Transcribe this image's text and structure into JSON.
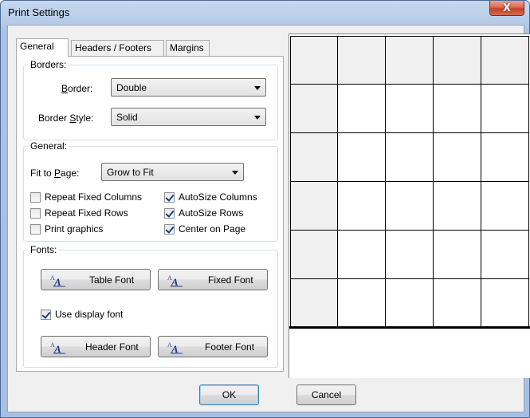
{
  "window": {
    "title": "Print Settings",
    "close_glyph": "X"
  },
  "tabs": [
    {
      "label": "General",
      "active": true
    },
    {
      "label": "Headers / Footers",
      "active": false
    },
    {
      "label": "Margins",
      "active": false
    }
  ],
  "borders": {
    "legend": "Borders:",
    "border_label_pre": "",
    "border_label_u": "B",
    "border_label_post": "order:",
    "border_value": "Double",
    "style_label_pre": "Border ",
    "style_label_u": "S",
    "style_label_post": "tyle:",
    "style_value": "Solid"
  },
  "general": {
    "legend": "General:",
    "fit_label_pre": "Fit to ",
    "fit_label_u": "P",
    "fit_label_post": "age:",
    "fit_value": "Grow to Fit",
    "checks": [
      {
        "label": "Repeat Fixed Columns",
        "checked": false
      },
      {
        "label": "AutoSize Columns",
        "checked": true
      },
      {
        "label": "Repeat Fixed Rows",
        "checked": false
      },
      {
        "label": "AutoSize Rows",
        "checked": true
      },
      {
        "label": "Print graphics",
        "checked": false
      },
      {
        "label": "Center on Page",
        "checked": true
      }
    ]
  },
  "fonts": {
    "legend": "Fonts:",
    "table_font": "Table Font",
    "fixed_font": "Fixed Font",
    "use_display_font": "Use display font",
    "use_display_checked": true,
    "header_font": "Header Font",
    "footer_font": "Footer Font"
  },
  "buttons": {
    "ok": "OK",
    "cancel": "Cancel"
  },
  "preview": {
    "columns": 5,
    "rows": 6,
    "fixed_rows": 1,
    "fixed_columns": 1
  },
  "icons": {
    "font": "font-icon",
    "checkbox": "checkmark-icon"
  },
  "colors": {
    "fixed_cell": "#f0f0f0",
    "grid_line": "#000000",
    "check_mark": "#1c3f8a"
  }
}
